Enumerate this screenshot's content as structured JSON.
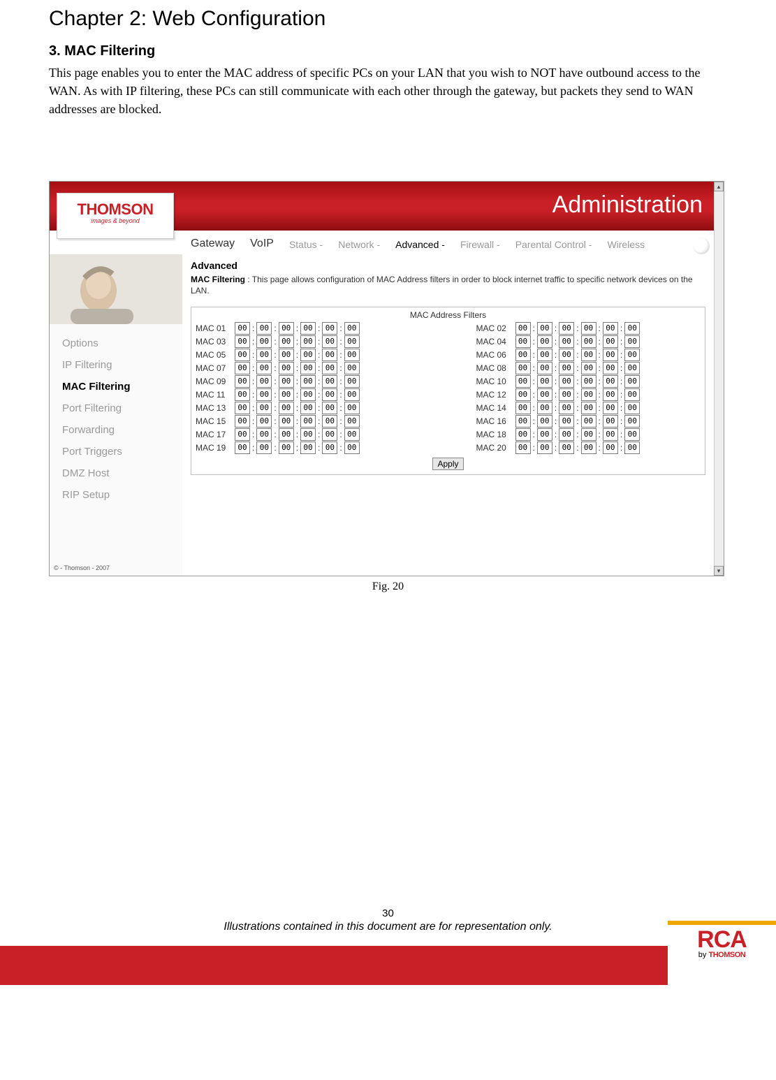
{
  "chapter_title": "Chapter 2: Web Configuration",
  "section_title": "3. MAC Filtering",
  "body_text": "This page enables you to enter the MAC address of specific PCs on your LAN that you wish to NOT have outbound access to the WAN. As with IP filtering, these PCs can still communicate with each other through the gateway, but packets they send to WAN addresses are blocked.",
  "figure_caption": "Fig. 20",
  "page_number": "30",
  "disclaimer": "Illustrations contained in this document are for representation only.",
  "logo": {
    "name": "THOMSON",
    "tagline": "images & beyond"
  },
  "header_title": "Administration",
  "tabs": {
    "app": [
      "Gateway",
      "VoIP"
    ],
    "sub": [
      "Status -",
      "Network -",
      "Advanced -",
      "Firewall -",
      "Parental Control -",
      "Wireless"
    ],
    "active_sub": 2
  },
  "sidebar": {
    "items": [
      "Options",
      "IP Filtering",
      "MAC Filtering",
      "Port Filtering",
      "Forwarding",
      "Port Triggers",
      "DMZ Host",
      "RIP Setup"
    ],
    "active_index": 2
  },
  "panel": {
    "heading": "Advanced",
    "label": "MAC Filtering",
    "desc_rest": " :  This page allows configuration of MAC Address filters in order to block internet traffic to specific network devices on the LAN.",
    "box_title": "MAC Address Filters",
    "apply_label": "Apply",
    "mac_rows": [
      {
        "n": "01",
        "v": [
          "00",
          "00",
          "00",
          "00",
          "00",
          "00"
        ]
      },
      {
        "n": "02",
        "v": [
          "00",
          "00",
          "00",
          "00",
          "00",
          "00"
        ]
      },
      {
        "n": "03",
        "v": [
          "00",
          "00",
          "00",
          "00",
          "00",
          "00"
        ]
      },
      {
        "n": "04",
        "v": [
          "00",
          "00",
          "00",
          "00",
          "00",
          "00"
        ]
      },
      {
        "n": "05",
        "v": [
          "00",
          "00",
          "00",
          "00",
          "00",
          "00"
        ]
      },
      {
        "n": "06",
        "v": [
          "00",
          "00",
          "00",
          "00",
          "00",
          "00"
        ]
      },
      {
        "n": "07",
        "v": [
          "00",
          "00",
          "00",
          "00",
          "00",
          "00"
        ]
      },
      {
        "n": "08",
        "v": [
          "00",
          "00",
          "00",
          "00",
          "00",
          "00"
        ]
      },
      {
        "n": "09",
        "v": [
          "00",
          "00",
          "00",
          "00",
          "00",
          "00"
        ]
      },
      {
        "n": "10",
        "v": [
          "00",
          "00",
          "00",
          "00",
          "00",
          "00"
        ]
      },
      {
        "n": "11",
        "v": [
          "00",
          "00",
          "00",
          "00",
          "00",
          "00"
        ]
      },
      {
        "n": "12",
        "v": [
          "00",
          "00",
          "00",
          "00",
          "00",
          "00"
        ]
      },
      {
        "n": "13",
        "v": [
          "00",
          "00",
          "00",
          "00",
          "00",
          "00"
        ]
      },
      {
        "n": "14",
        "v": [
          "00",
          "00",
          "00",
          "00",
          "00",
          "00"
        ]
      },
      {
        "n": "15",
        "v": [
          "00",
          "00",
          "00",
          "00",
          "00",
          "00"
        ]
      },
      {
        "n": "16",
        "v": [
          "00",
          "00",
          "00",
          "00",
          "00",
          "00"
        ]
      },
      {
        "n": "17",
        "v": [
          "00",
          "00",
          "00",
          "00",
          "00",
          "00"
        ]
      },
      {
        "n": "18",
        "v": [
          "00",
          "00",
          "00",
          "00",
          "00",
          "00"
        ]
      },
      {
        "n": "19",
        "v": [
          "00",
          "00",
          "00",
          "00",
          "00",
          "00"
        ]
      },
      {
        "n": "20",
        "v": [
          "00",
          "00",
          "00",
          "00",
          "00",
          "00"
        ]
      }
    ]
  },
  "copyright": "© - Thomson - 2007",
  "footer_brand": {
    "main": "RCA",
    "by": "by",
    "sub": "THOMSON"
  }
}
